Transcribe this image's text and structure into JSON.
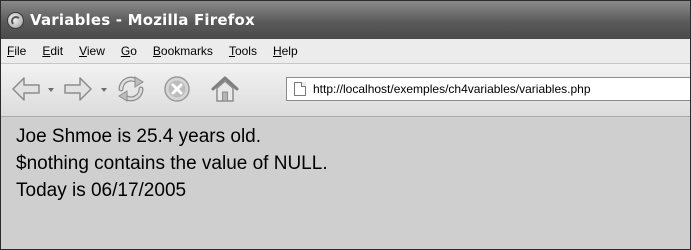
{
  "window": {
    "title": "Variables - Mozilla Firefox"
  },
  "menubar": {
    "items": [
      {
        "accel": "F",
        "rest": "ile"
      },
      {
        "accel": "E",
        "rest": "dit"
      },
      {
        "accel": "V",
        "rest": "iew"
      },
      {
        "accel": "G",
        "rest": "o"
      },
      {
        "accel": "B",
        "rest": "ookmarks"
      },
      {
        "accel": "T",
        "rest": "ools"
      },
      {
        "accel": "H",
        "rest": "elp"
      }
    ]
  },
  "toolbar": {
    "icons": [
      "back-arrow-icon",
      "forward-arrow-icon",
      "reload-icon",
      "stop-icon",
      "home-icon"
    ],
    "url": "http://localhost/exemples/ch4variables/variables.php"
  },
  "page": {
    "lines": [
      "Joe Shmoe is 25.4 years old.",
      "$nothing contains the value of NULL.",
      "Today is 06/17/2005"
    ]
  },
  "colors": {
    "title_bar": "#5a5a5a",
    "content_bg": "#cfcfcf",
    "toolbar_bg": "#e6e6e6"
  }
}
